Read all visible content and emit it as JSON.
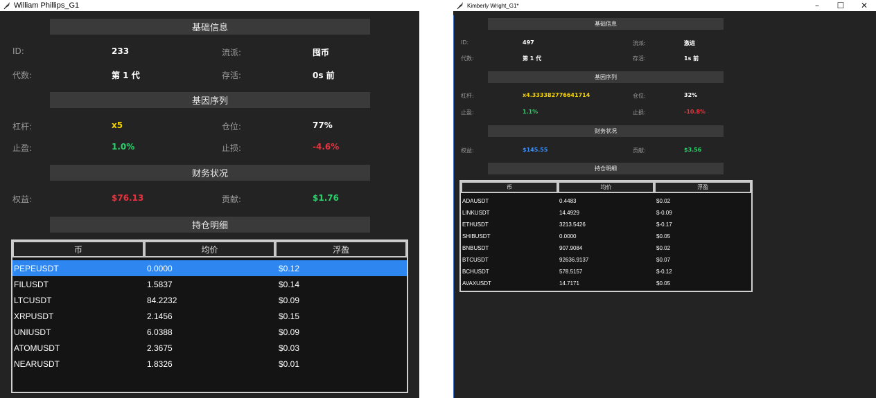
{
  "colors": {
    "panel_bg": "#232323",
    "header_bg": "#3a3a3a",
    "yellow": "#f5d300",
    "green": "#27d36a",
    "red": "#e8323e",
    "blue": "#3a8df5",
    "selection": "#2e86f0"
  },
  "left": {
    "window_title": "William Phillips_G1",
    "section_basic": "基础信息",
    "id_label": "ID:",
    "id_value": "233",
    "school_label": "流派:",
    "school_value": "囤币",
    "generation_label": "代数:",
    "generation_value": "第 1 代",
    "alive_label": "存活:",
    "alive_value": "0s 前",
    "section_genes": "基因序列",
    "leverage_label": "杠杆:",
    "leverage_value": "x5",
    "position_label": "仓位:",
    "position_value": "77%",
    "tp_label": "止盈:",
    "tp_value": "1.0%",
    "sl_label": "止损:",
    "sl_value": "-4.6%",
    "section_finance": "财务状况",
    "equity_label": "权益:",
    "equity_value": "$76.13",
    "contrib_label": "贡献:",
    "contrib_value": "$1.76",
    "section_holdings": "持仓明细",
    "columns": [
      "币",
      "均价",
      "浮盈"
    ],
    "rows": [
      {
        "coin": "PEPEUSDT",
        "avg": "0.0000",
        "pnl": "$0.12"
      },
      {
        "coin": "FILUSDT",
        "avg": "1.5837",
        "pnl": "$0.14"
      },
      {
        "coin": "LTCUSDT",
        "avg": "84.2232",
        "pnl": "$0.09"
      },
      {
        "coin": "XRPUSDT",
        "avg": "2.1456",
        "pnl": "$0.15"
      },
      {
        "coin": "UNIUSDT",
        "avg": "6.0388",
        "pnl": "$0.09"
      },
      {
        "coin": "ATOMUSDT",
        "avg": "2.3675",
        "pnl": "$0.03"
      },
      {
        "coin": "NEARUSDT",
        "avg": "1.8326",
        "pnl": "$0.01"
      }
    ]
  },
  "right": {
    "window_title": "Kimberly Wright_G1*",
    "window_controls": [
      "–",
      "☐",
      "✕"
    ],
    "section_basic": "基础信息",
    "id_label": "ID:",
    "id_value": "497",
    "school_label": "流派:",
    "school_value": "激进",
    "generation_label": "代数:",
    "generation_value": "第 1 代",
    "alive_label": "存活:",
    "alive_value": "1s 前",
    "section_genes": "基因序列",
    "leverage_label": "杠杆:",
    "leverage_value": "x4.333382776641714",
    "position_label": "仓位:",
    "position_value": "32%",
    "tp_label": "止盈:",
    "tp_value": "1.1%",
    "sl_label": "止损:",
    "sl_value": "-10.8%",
    "section_finance": "财务状况",
    "equity_label": "权益:",
    "equity_value": "$145.55",
    "contrib_label": "贡献:",
    "contrib_value": "$3.56",
    "section_holdings": "持仓明细",
    "columns": [
      "币",
      "均价",
      "浮盈"
    ],
    "rows": [
      {
        "coin": "ADAUSDT",
        "avg": "0.4483",
        "pnl": "$0.02"
      },
      {
        "coin": "LINKUSDT",
        "avg": "14.4929",
        "pnl": "$-0.09"
      },
      {
        "coin": "ETHUSDT",
        "avg": "3213.5426",
        "pnl": "$-0.17"
      },
      {
        "coin": "SHIBUSDT",
        "avg": "0.0000",
        "pnl": "$0.05"
      },
      {
        "coin": "BNBUSDT",
        "avg": "907.9084",
        "pnl": "$0.02"
      },
      {
        "coin": "BTCUSDT",
        "avg": "92636.9137",
        "pnl": "$0.07"
      },
      {
        "coin": "BCHUSDT",
        "avg": "578.5157",
        "pnl": "$-0.12"
      },
      {
        "coin": "AVAXUSDT",
        "avg": "14.7171",
        "pnl": "$0.05"
      }
    ]
  }
}
